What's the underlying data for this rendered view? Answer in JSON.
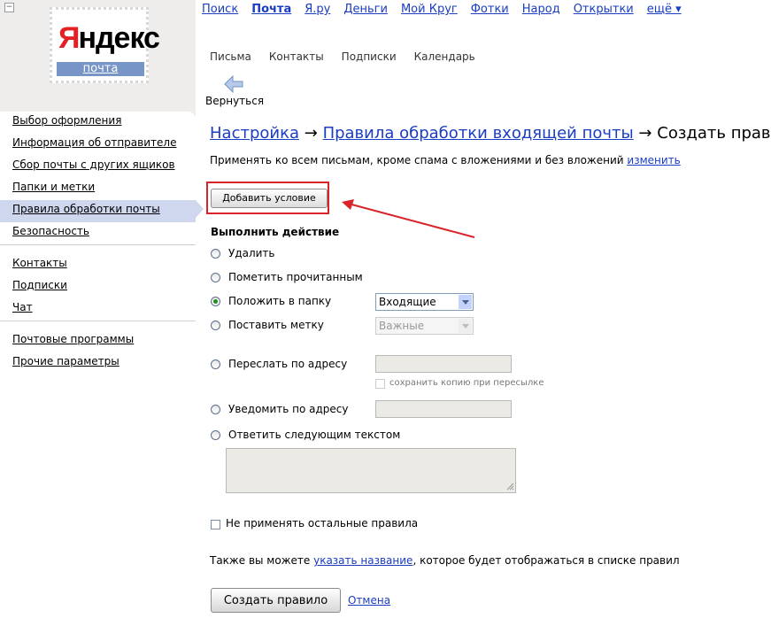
{
  "logo": {
    "brand_first": "Я",
    "brand_rest": "ндекс",
    "subtitle": "почта"
  },
  "topnav": [
    "Поиск",
    "Почта",
    "Я.ру",
    "Деньги",
    "Мой Круг",
    "Фотки",
    "Народ",
    "Открытки",
    "ещё ▾"
  ],
  "subnav": [
    "Письма",
    "Контакты",
    "Подписки",
    "Календарь"
  ],
  "back_label": "Вернуться",
  "sidebar": {
    "group1": [
      "Выбор оформления",
      "Информация об отправителе",
      "Сбор почты с других ящиков",
      "Папки и метки",
      "Правила обработки почты",
      "Безопасность"
    ],
    "group2": [
      "Контакты",
      "Подписки",
      "Чат"
    ],
    "group3": [
      "Почтовые программы",
      "Прочие параметры"
    ],
    "active": "Правила обработки почты"
  },
  "breadcrumb": {
    "item1": "Настройка",
    "arrow": "→",
    "item2": "Правила обработки входящей почты",
    "current": "Создать правило"
  },
  "apply": {
    "text": "Применять ко всем письмам, кроме спама с вложениями и без вложений",
    "link": "изменить"
  },
  "add_condition": "Добавить условие",
  "actions": {
    "title": "Выполнить действие",
    "delete": "Удалить",
    "mark_read": "Пометить прочитанным",
    "move_folder": "Положить в папку",
    "set_label": "Поставить метку",
    "forward": "Переслать по адресу",
    "keep_copy": "сохранить копию при пересылке",
    "notify": "Уведомить по адресу",
    "reply": "Ответить следующим текстом",
    "folder_value": "Входящие",
    "label_value": "Важные"
  },
  "dont_apply": "Не применять остальные правила",
  "name_hint": {
    "before": "Также вы можете",
    "link": "указать название",
    "after": ", которое будет отображаться в списке правил"
  },
  "create_button": "Создать правило",
  "cancel_link": "Отмена"
}
